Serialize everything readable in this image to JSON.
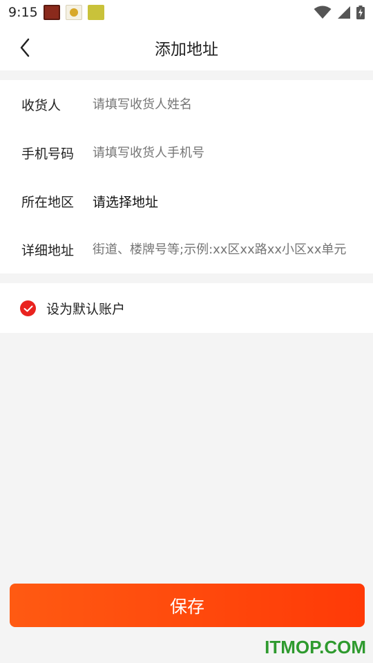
{
  "status_bar": {
    "time": "9:15",
    "app_icons": [
      "app-icon-1",
      "app-icon-2",
      "app-icon-3"
    ],
    "icons": [
      "wifi-icon",
      "signal-icon",
      "battery-charging-icon"
    ]
  },
  "header": {
    "title": "添加地址",
    "back_icon": "chevron-left-icon"
  },
  "form": {
    "rows": [
      {
        "label": "收货人",
        "placeholder": "请填写收货人姓名",
        "value": ""
      },
      {
        "label": "手机号码",
        "placeholder": "请填写收货人手机号",
        "value": ""
      },
      {
        "label": "所在地区",
        "value": "请选择地址"
      },
      {
        "label": "详细地址",
        "placeholder": "街道、楼牌号等;示例:xx区xx路xx小区xx单元",
        "value": ""
      }
    ]
  },
  "default_option": {
    "label": "设为默认账户",
    "checked": true,
    "accent": "#e9231f"
  },
  "save_button": {
    "label": "保存",
    "color": "#ff4a0c"
  },
  "watermark": "ITMOP.COM"
}
